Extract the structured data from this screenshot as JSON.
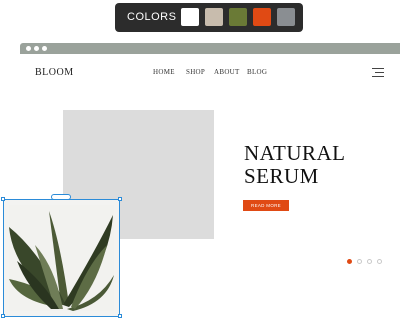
{
  "palette": {
    "label": "COLORS",
    "swatches": [
      {
        "name": "white",
        "color": "#ffffff"
      },
      {
        "name": "beige",
        "color": "#c8bcad"
      },
      {
        "name": "olive",
        "color": "#6a7a36"
      },
      {
        "name": "orange",
        "color": "#e04a14"
      },
      {
        "name": "gray",
        "color": "#8a8e92"
      }
    ]
  },
  "site": {
    "logo": "BLOOM",
    "nav": [
      "HOME",
      "SHOP",
      "ABOUT",
      "BLOG"
    ],
    "hero": {
      "title_line1": "NATURAL",
      "title_line2": "SERUM",
      "cta_label": "READ MORE"
    },
    "pager": {
      "count": 4,
      "active_index": 0
    }
  },
  "colors": {
    "accent": "#e04a14",
    "selection": "#2b8bd8"
  }
}
